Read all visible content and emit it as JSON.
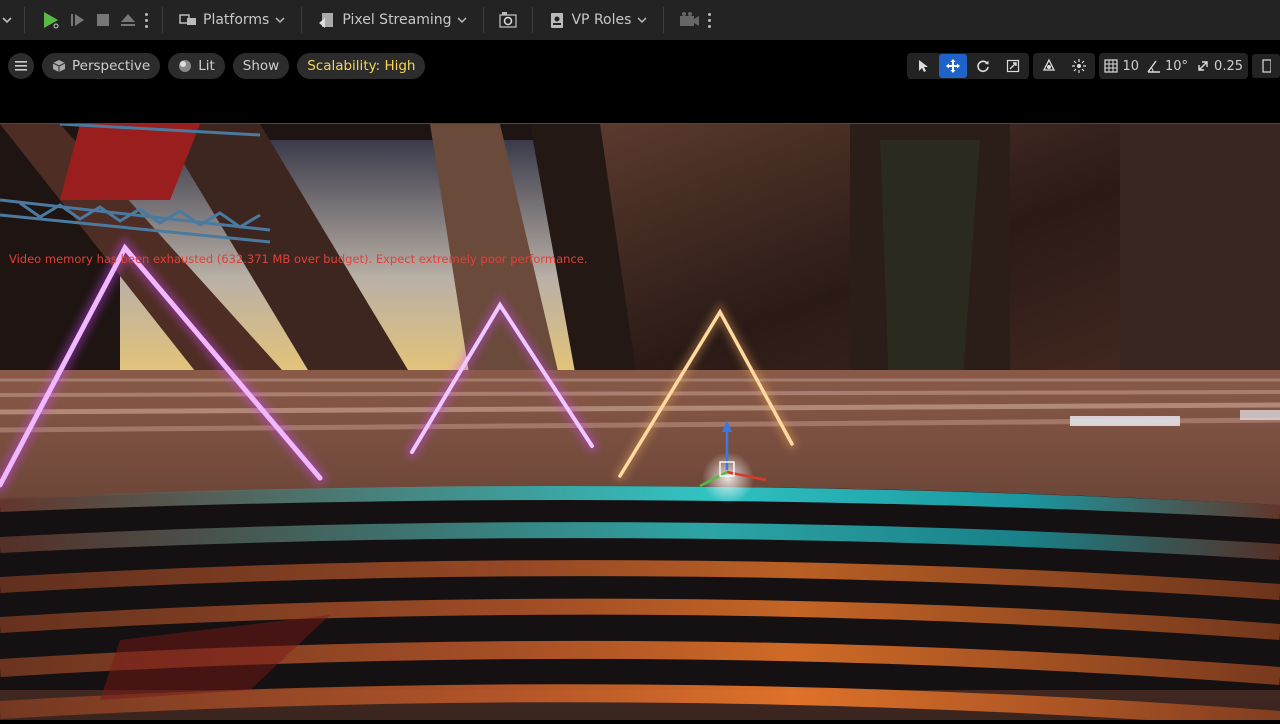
{
  "toolbar": {
    "platforms_label": "Platforms",
    "pixel_streaming_label": "Pixel Streaming",
    "vp_roles_label": "VP Roles"
  },
  "viewport": {
    "perspective_label": "Perspective",
    "lit_label": "Lit",
    "show_label": "Show",
    "scalability_label": "Scalability: High",
    "grid_snap_value": "10",
    "rotation_snap_value": "10°",
    "scale_snap_value": "0.25"
  },
  "scene": {
    "warning_text": "Video memory has been exhausted (632.371 MB over budget). Expect extremely poor performance."
  },
  "colors": {
    "play_green": "#58b947",
    "accent_blue": "#1f62c9",
    "scalability_yellow": "#f5d55a",
    "warning_red": "#e0413a",
    "neon_magenta": "#d24bff",
    "neon_gold": "#f0b060",
    "stripe_cyan": "#34d6d6",
    "stripe_orange": "#f07a2a"
  }
}
